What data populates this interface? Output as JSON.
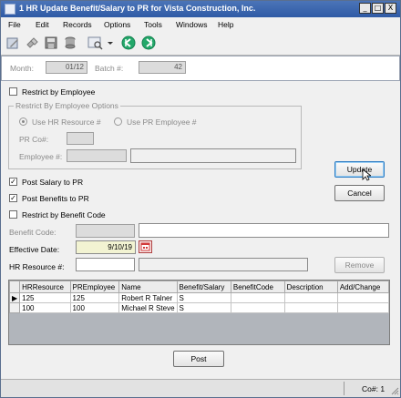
{
  "window": {
    "title": "1 HR Update Benefit/Salary to PR for Vista Construction, Inc.",
    "controls": {
      "minimize": "_",
      "maximize": "□",
      "close": "X"
    }
  },
  "menu": [
    "File",
    "Edit",
    "Records",
    "Options",
    "Tools",
    "Windows",
    "Help"
  ],
  "toolbar": {
    "icons": [
      "edit-icon",
      "link-icon",
      "save-disk-icon",
      "database-icon",
      "find-icon",
      "dropdown-arrow-icon",
      "back-arrow-icon",
      "forward-arrow-icon"
    ]
  },
  "batch": {
    "month_label": "Month:",
    "month_value": "01/12",
    "batch_label": "Batch #:",
    "batch_value": "42"
  },
  "form": {
    "restrict_by_employee": {
      "label": "Restrict by Employee",
      "checked": false
    },
    "restrict_options": {
      "group_title": "Restrict By Employee Options",
      "radio_hr": "Use HR Resource #",
      "radio_pr": "Use PR Employee #",
      "prco_label": "PR Co#:",
      "employee_label": "Employee #:"
    },
    "post_salary": {
      "label": "Post Salary to PR",
      "checked": true,
      "mark": "✓"
    },
    "post_benefits": {
      "label": "Post Benefits to PR",
      "checked": true,
      "mark": "✓"
    },
    "restrict_benefit_code": {
      "label": "Restrict by Benefit Code",
      "checked": false
    },
    "benefit_code_label": "Benefit Code:",
    "effective_date_label": "Effective Date:",
    "effective_date_value": "9/10/19",
    "hr_resource_label": "HR Resource #:"
  },
  "buttons": {
    "update": "Update",
    "cancel": "Cancel",
    "remove": "Remove",
    "post": "Post"
  },
  "grid": {
    "columns": [
      "HRResource",
      "PREmployee",
      "Name",
      "Benefit/Salary",
      "BenefitCode",
      "Description",
      "Add/Change"
    ],
    "rows": [
      {
        "selector": "▶",
        "cells": [
          "125",
          "125",
          "Robert R Talner",
          "S",
          "",
          "",
          ""
        ]
      },
      {
        "selector": "",
        "cells": [
          "100",
          "100",
          "Michael R Steve",
          "S",
          "",
          "",
          ""
        ]
      }
    ]
  },
  "status": {
    "company": "Co#: 1"
  },
  "colors": {
    "titlebar": "#2f5ba6",
    "toolbar_green": "#23a86a",
    "date_field": "#f2f3d2",
    "calendar_red": "#d23a3a"
  }
}
